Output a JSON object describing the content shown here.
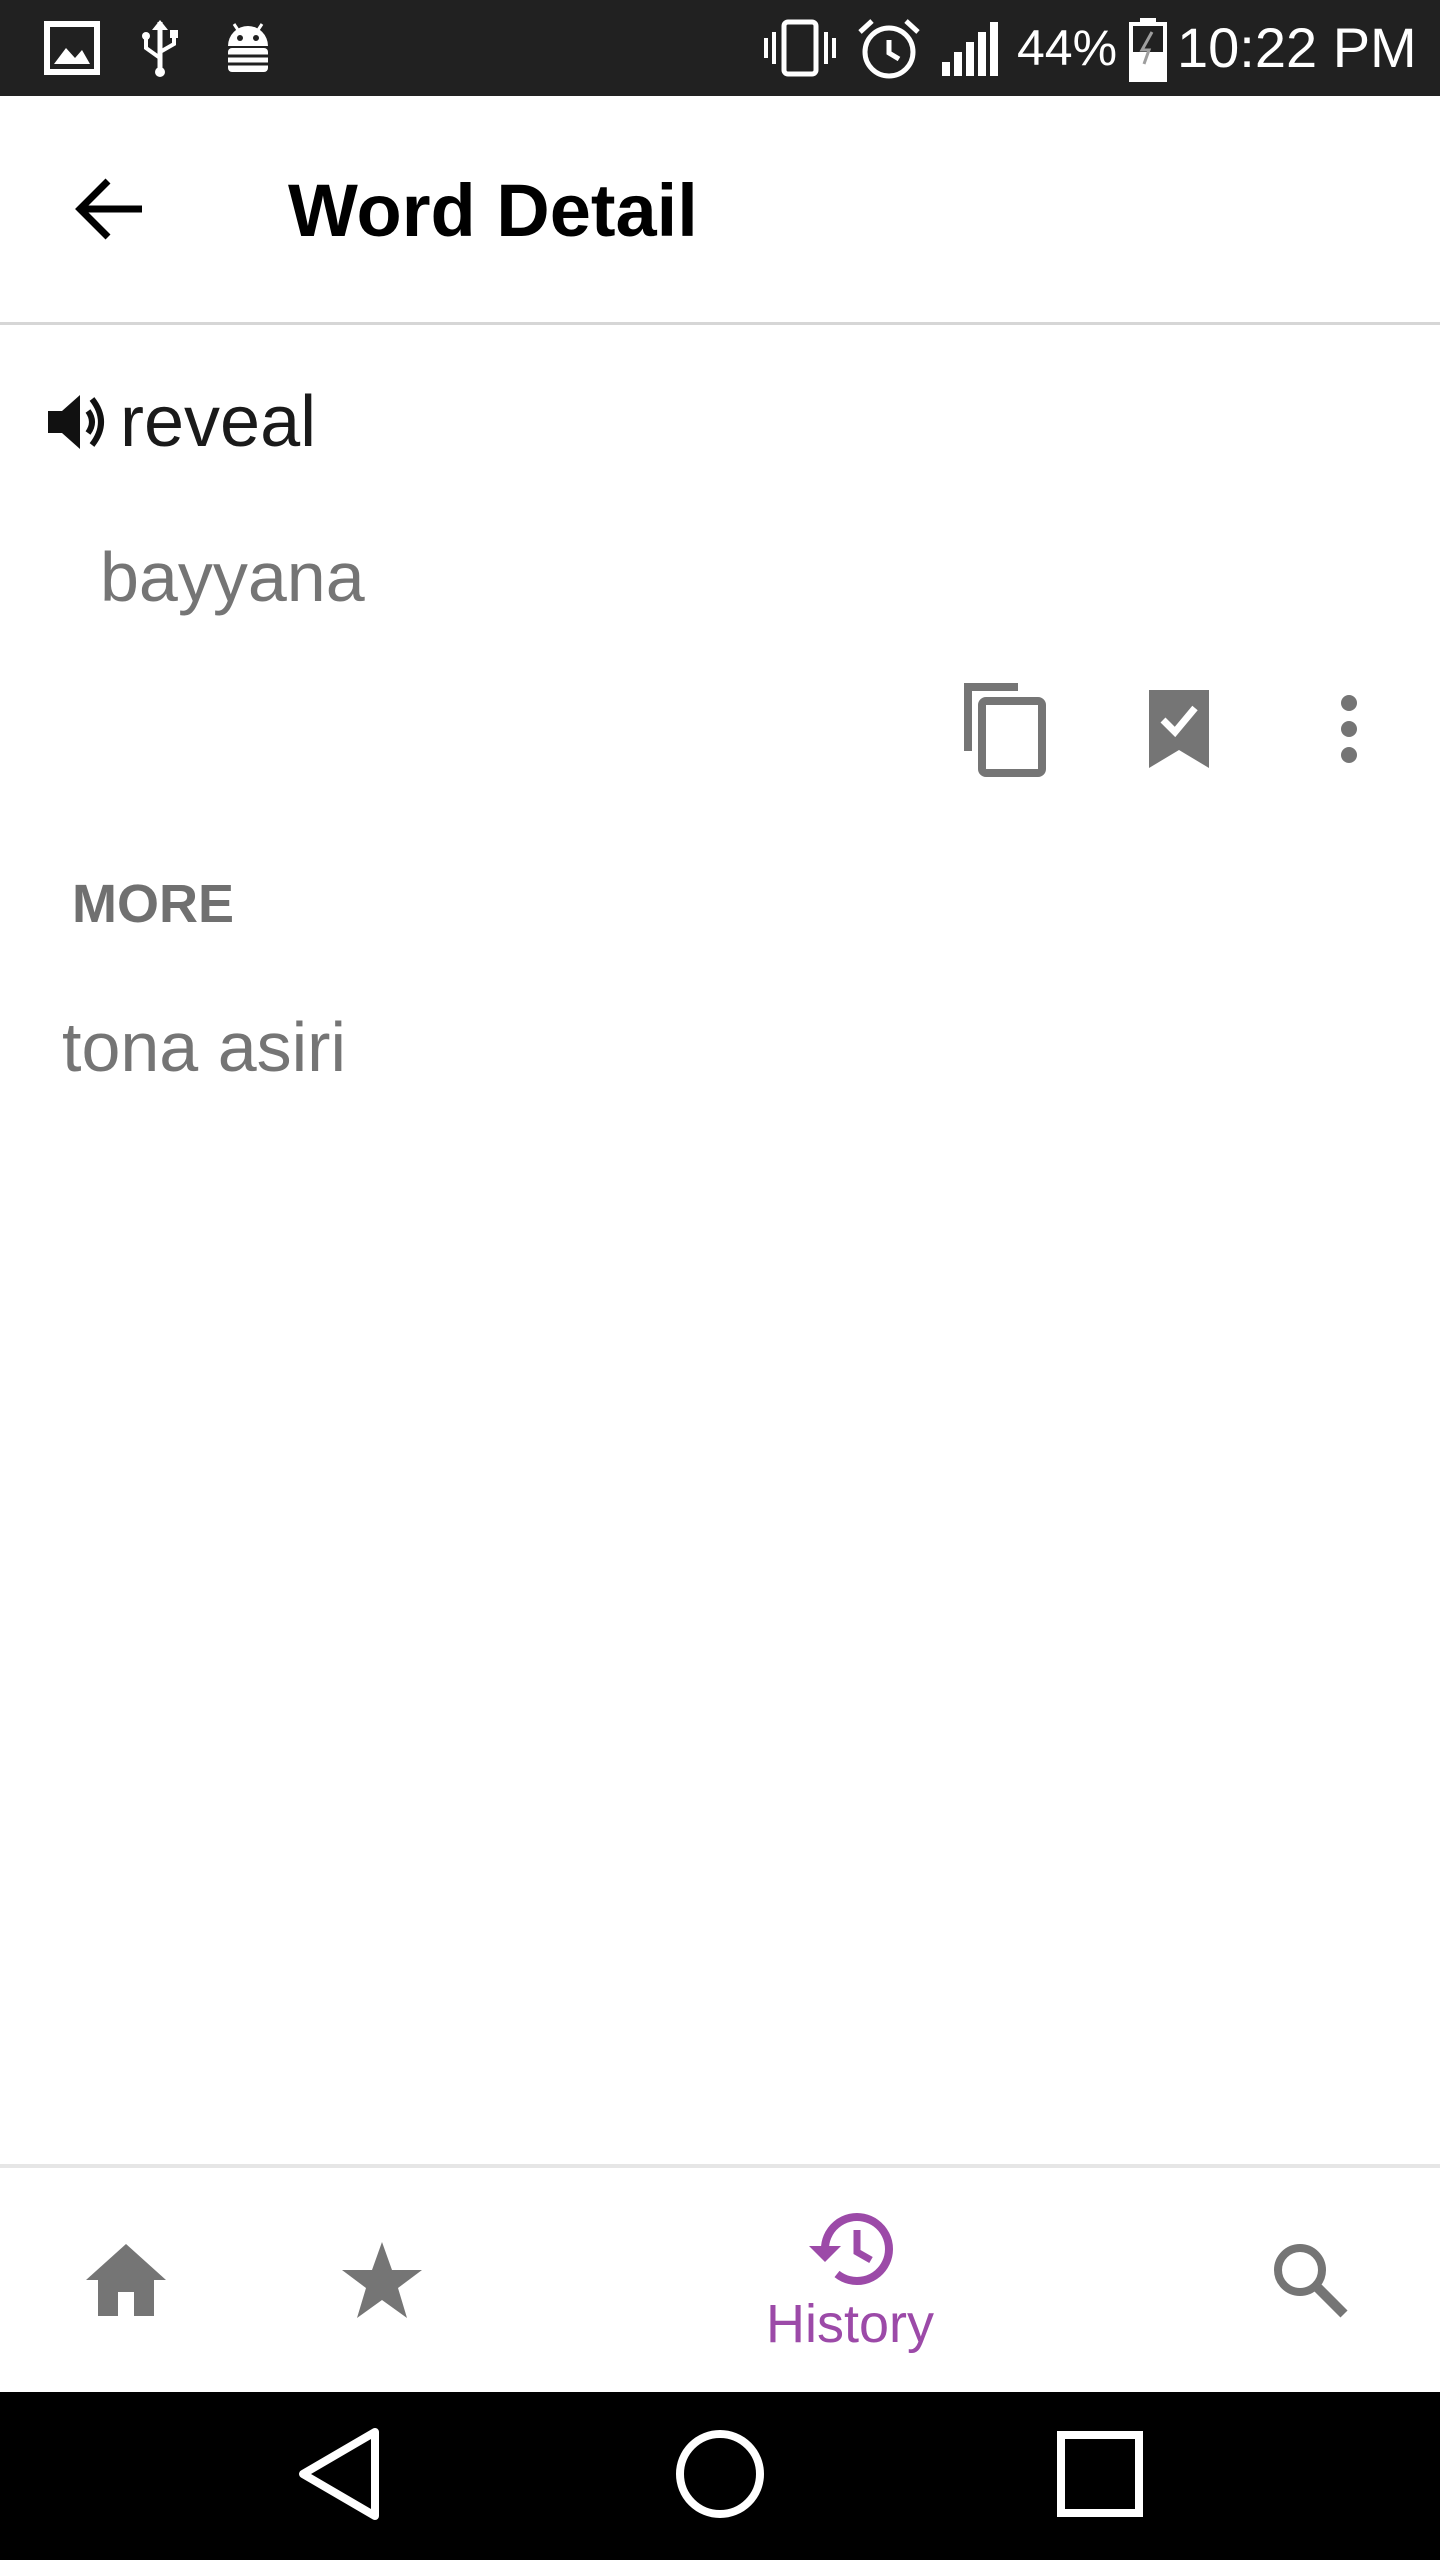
{
  "status_bar": {
    "battery_percent": "44%",
    "time": "10:22 PM",
    "left_icons": [
      "gallery-icon",
      "usb-icon",
      "android-debug-icon"
    ],
    "right_icons": [
      "vibrate-icon",
      "alarm-icon",
      "signal-icon",
      "battery-charging-icon"
    ]
  },
  "app_bar": {
    "title": "Word Detail",
    "back_icon": "arrow-back-icon"
  },
  "entry": {
    "word": "reveal",
    "speaker_icon": "speaker-icon",
    "translation": "bayyana",
    "actions": [
      "copy-icon",
      "bookmark-check-icon",
      "more-vertical-icon"
    ]
  },
  "more_section": {
    "header": "MORE",
    "items": [
      "tona asiri"
    ]
  },
  "bottom_nav": {
    "items": [
      {
        "icon": "home-icon",
        "label": ""
      },
      {
        "icon": "star-icon",
        "label": ""
      },
      {
        "icon": "history-icon",
        "label": "History",
        "selected": true
      },
      {
        "icon": "search-icon",
        "label": ""
      }
    ],
    "accent_color": "#9c4aa8",
    "inactive_color": "#757575"
  },
  "system_nav": {
    "buttons": [
      "back-triangle-icon",
      "home-circle-icon",
      "recents-square-icon"
    ]
  }
}
